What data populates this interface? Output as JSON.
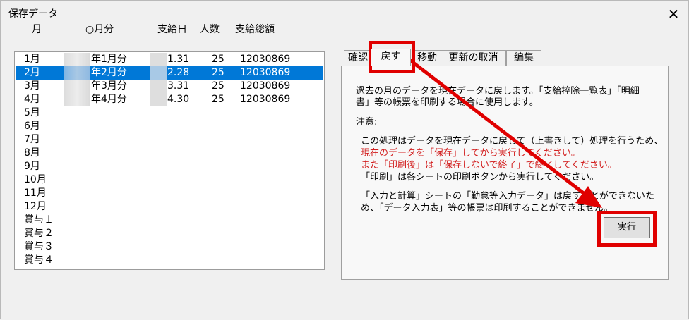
{
  "window": {
    "title": "保存データ",
    "close_glyph": "✕"
  },
  "columns": {
    "month": "月",
    "period": "○月分",
    "pay_date": "支給日",
    "count": "人数",
    "total": "支給総額"
  },
  "rows": [
    {
      "month": "1月",
      "period": "年1月分",
      "pay_date": "1.31",
      "count": "25",
      "total": "12030869"
    },
    {
      "month": "2月",
      "period": "年2月分",
      "pay_date": "2.28",
      "count": "25",
      "total": "12030869"
    },
    {
      "month": "3月",
      "period": "年3月分",
      "pay_date": "3.31",
      "count": "25",
      "total": "12030869"
    },
    {
      "month": "4月",
      "period": "年4月分",
      "pay_date": "4.30",
      "count": "25",
      "total": "12030869"
    },
    {
      "month": "5月"
    },
    {
      "month": "6月"
    },
    {
      "month": "7月"
    },
    {
      "month": "8月"
    },
    {
      "month": "9月"
    },
    {
      "month": "10月"
    },
    {
      "month": "11月"
    },
    {
      "month": "12月"
    },
    {
      "month": "賞与１"
    },
    {
      "month": "賞与２"
    },
    {
      "month": "賞与３"
    },
    {
      "month": "賞与４"
    }
  ],
  "selected_index": 1,
  "tabs": [
    "確認",
    "戻す",
    "移動",
    "更新の取消",
    "編集"
  ],
  "active_tab": "戻す",
  "panel": {
    "description_line1": "過去の月のデータを現在データに戻します。「支給控除一覧表」「明細",
    "description_line2": "書」等の帳票を印刷する場合に使用します。",
    "notice_label": "注意:",
    "note1_line1": "この処理はデータを現在データに戻して（上書きして）処理を行うため、",
    "note1_line2": "現在のデータを「保存」してから実行してください。",
    "note1_line3": "また「印刷後」は「保存しないで終了」で終了してください。",
    "note1_line4": "「印刷」は各シートの印刷ボタンから実行してください。",
    "note2_line1": "「入力と計算」シートの「勤怠等入力データ」は戻すことができないた",
    "note2_line2": "め、「データ入力表」等の帳票は印刷することができません。",
    "run_button": "実行"
  },
  "colors": {
    "highlight": "#e00000",
    "selection": "#0078d7",
    "warning_text": "#d21e1e"
  }
}
